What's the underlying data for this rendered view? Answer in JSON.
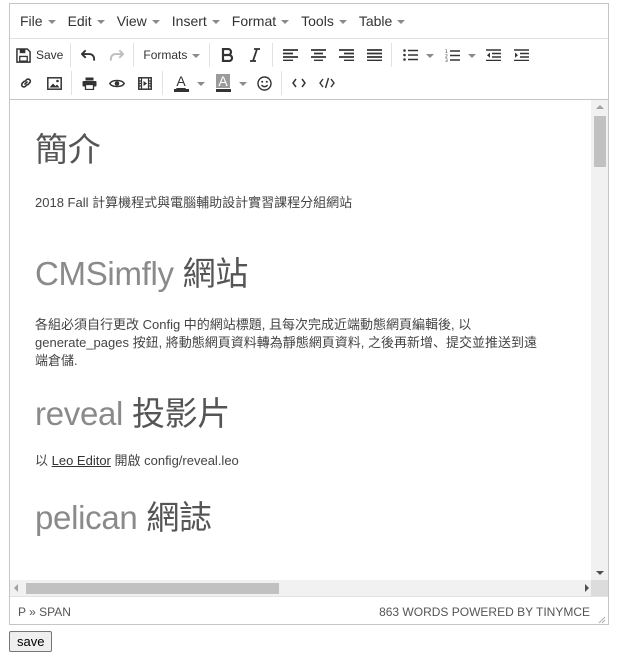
{
  "menubar": {
    "items": [
      "File",
      "Edit",
      "View",
      "Insert",
      "Format",
      "Tools",
      "Table"
    ]
  },
  "toolbar": {
    "save_label": "Save",
    "formats_label": "Formats",
    "text_color_letter": "A",
    "bg_color_letter": "A"
  },
  "content": {
    "h_intro": "簡介",
    "p_intro": "2018 Fall 計算機程式與電腦輔助設計實習課程分組網站",
    "h_cmsimfly_a": "CMSimfly",
    "h_cmsimfly_b": " 網站",
    "p_cmsimfly_line1": "各組必須自行更改 Config 中的網站標題, 且每次完成近端動態網頁編輯後, 以",
    "p_cmsimfly_line2": "generate_pages 按鈕, 將動態網頁資料轉為靜態網頁資料, 之後再新增、提交並推送到遠",
    "p_cmsimfly_line3": "端倉儲.",
    "h_reveal_a": "reveal",
    "h_reveal_b": " 投影片",
    "p_reveal_pre": "以 ",
    "p_reveal_link": "Leo Editor",
    "p_reveal_post": " 開啟 config/reveal.leo",
    "h_pelican_a": "pelican",
    "h_pelican_b": " 網誌"
  },
  "statusbar": {
    "path": "P » SPAN",
    "wordcount": "863 WORDS POWERED BY TINYMCE"
  },
  "form": {
    "save_button_label": "save"
  }
}
